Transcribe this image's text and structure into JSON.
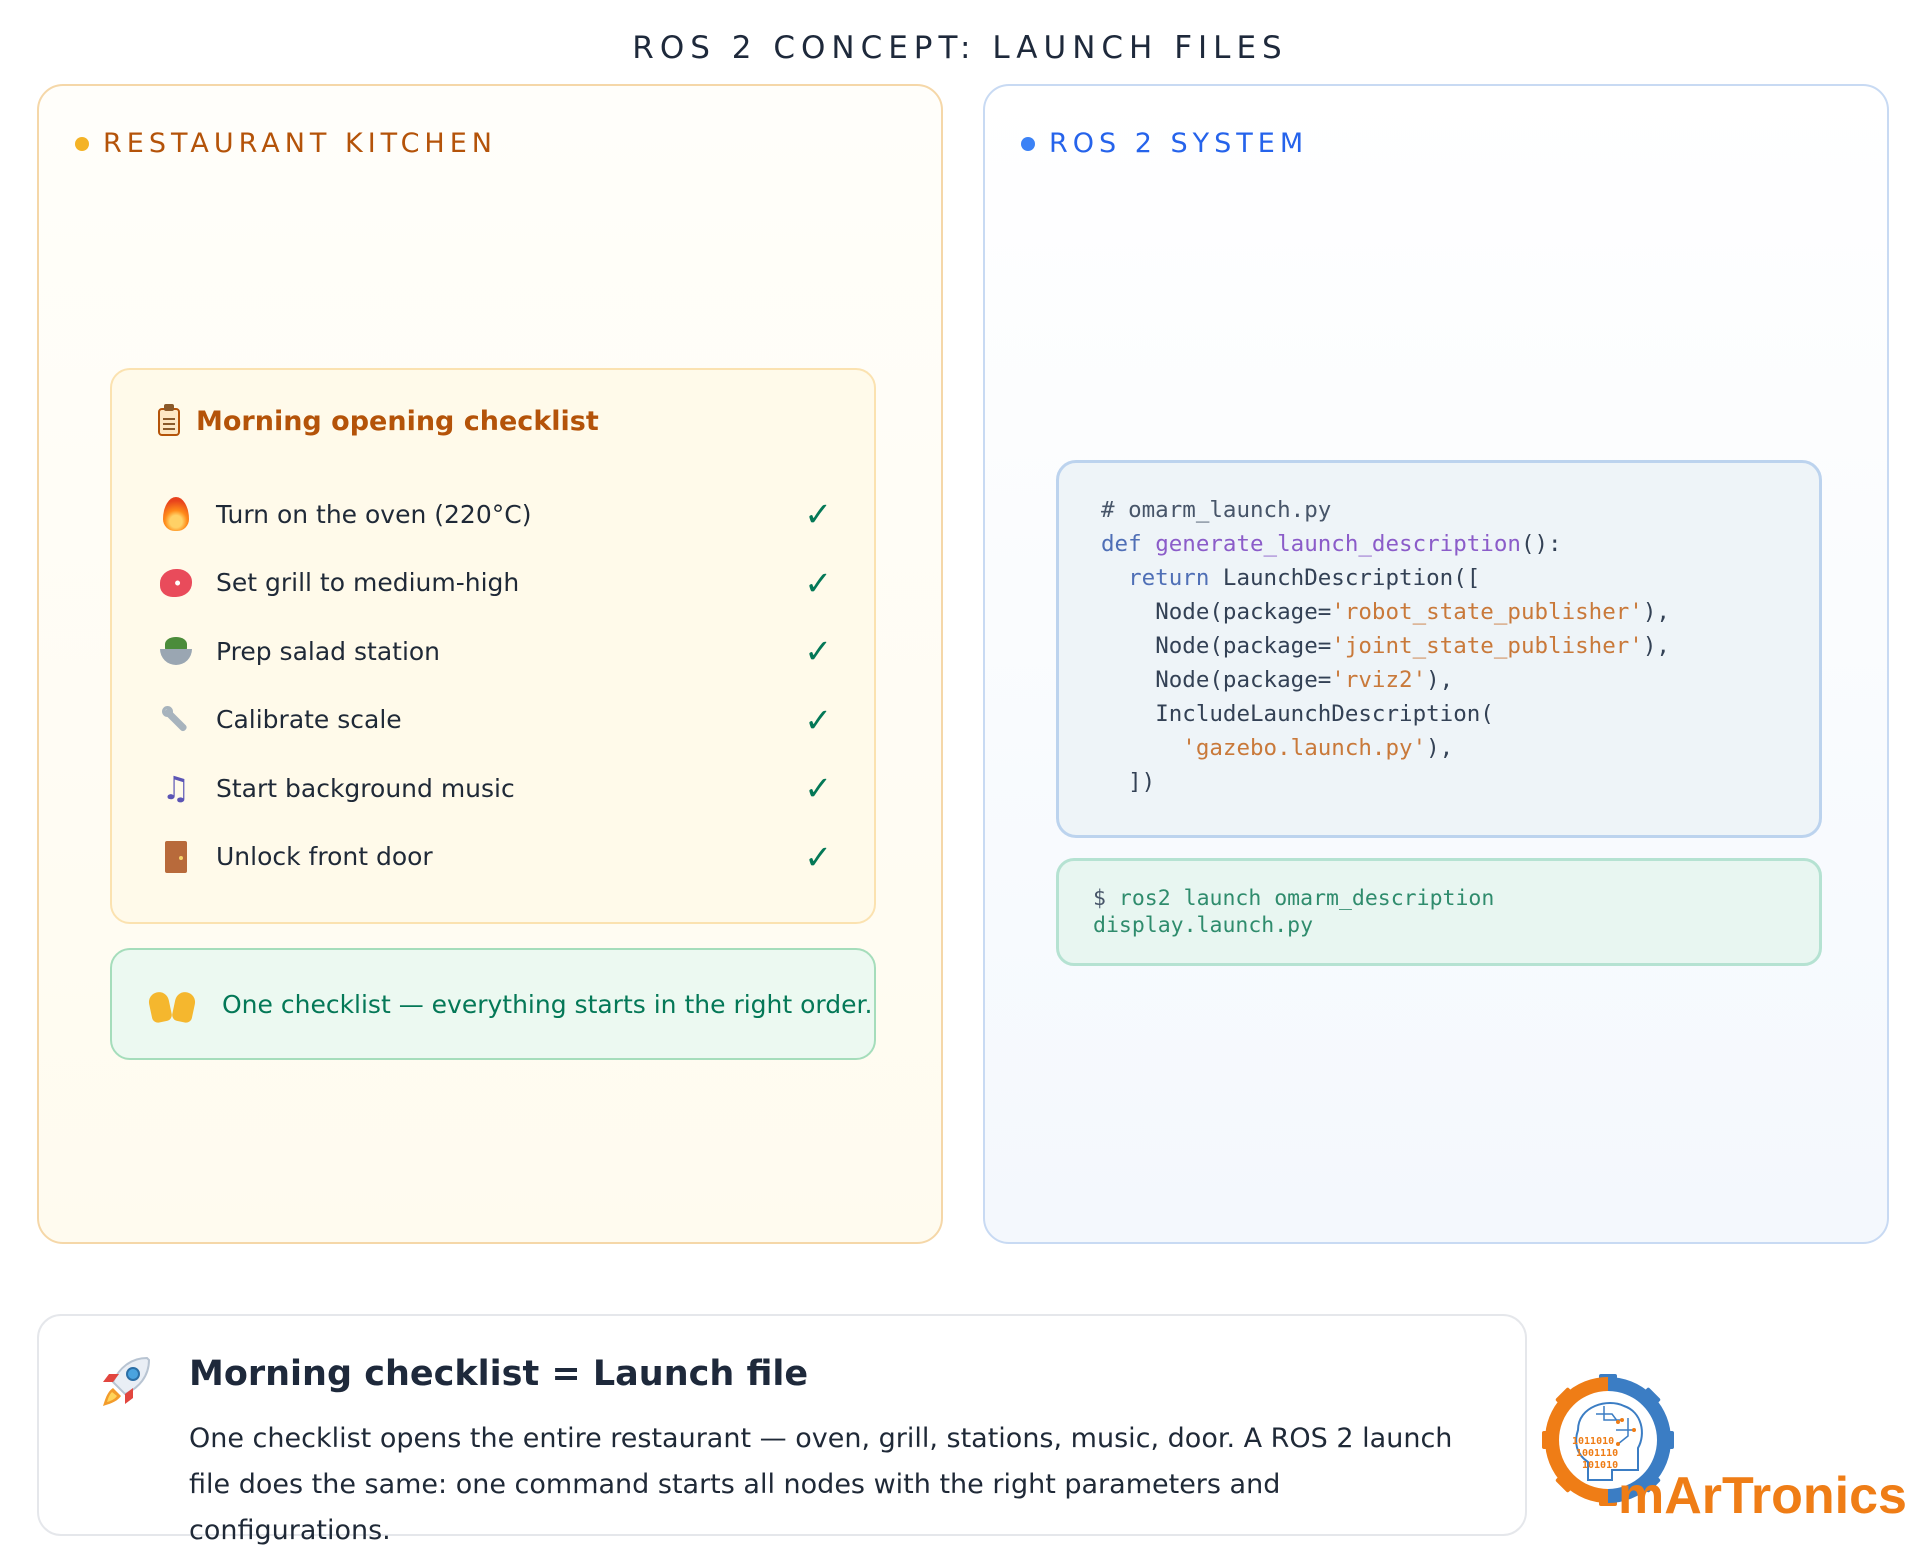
{
  "page": {
    "title": "ROS 2 CONCEPT: LAUNCH FILES"
  },
  "kitchen": {
    "heading": "RESTAURANT KITCHEN",
    "checklist": {
      "title": "Morning opening checklist",
      "items": [
        {
          "icon": "flame-icon",
          "label": "Turn on the oven (220°C)",
          "check": "✓"
        },
        {
          "icon": "steak-icon",
          "label": "Set grill to medium-high",
          "check": "✓"
        },
        {
          "icon": "salad-bowl-icon",
          "label": "Prep salad station",
          "check": "✓"
        },
        {
          "icon": "wrench-icon",
          "label": "Calibrate scale",
          "check": "✓"
        },
        {
          "icon": "music-notes-icon",
          "label": "Start background music",
          "check": "✓"
        },
        {
          "icon": "door-icon",
          "label": "Unlock front door",
          "check": "✓"
        }
      ]
    },
    "summary": "One checklist — everything starts in the right order."
  },
  "ros": {
    "heading": "ROS 2 SYSTEM",
    "code": {
      "comment": "# omarm_launch.py",
      "def_kw": "def",
      "fn_name": "generate_launch_description",
      "def_tail": "():",
      "return_kw": "return",
      "return_tail": " LaunchDescription([",
      "node_prefix": "Node(package=",
      "node_suffix": "),",
      "nodes": [
        "'robot_state_publisher'",
        "'joint_state_publisher'",
        "'rviz2'"
      ],
      "include_open": "IncludeLaunchDescription(",
      "include_arg": "'gazebo.launch.py'",
      "include_close": "),",
      "closing": "])"
    },
    "command": {
      "prompt": "$",
      "line1": "ros2 launch omarm_description",
      "line2": "display.launch.py"
    }
  },
  "bottom": {
    "title": "Morning checklist = Launch file",
    "description": "One checklist opens the entire restaurant — oven, grill, stations, music, door. A ROS 2 launch file does the same: one command starts all nodes with the right parameters and configurations."
  },
  "logo": {
    "word": "mArTronics",
    "binary": [
      "1011010",
      "1001110",
      "101010"
    ]
  },
  "colors": {
    "kitchen_accent": "#b45309",
    "ros_accent": "#2563eb",
    "check_green": "#047857",
    "logo_orange": "#ef7d16",
    "logo_blue": "#3b7dc4"
  }
}
